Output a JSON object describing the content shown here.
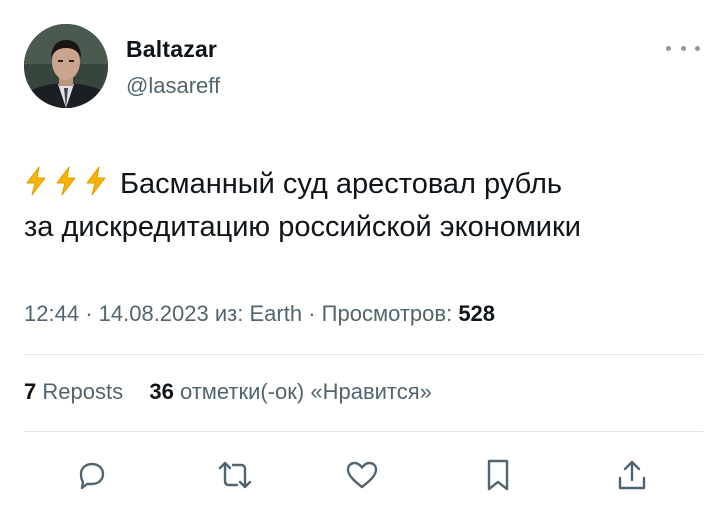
{
  "tweet": {
    "author_name": "Baltazar",
    "author_handle": "@lasareff",
    "emoji_prefix": "⚡⚡⚡",
    "text_line1": "Басманный суд арестовал рубль",
    "text_line2": "за дискредитацию российской экономики",
    "time": "12:44",
    "date": "14.08.2023",
    "source_prefix": "из:",
    "source": "Earth",
    "views_label": "Просмотров:",
    "views_count": "528",
    "reposts_count": "7",
    "reposts_label": "Reposts",
    "likes_count": "36",
    "likes_label": "отметки(-ок) «Нравится»"
  },
  "actions": [
    {
      "name": "reply",
      "icon": "speech-bubble-icon"
    },
    {
      "name": "repost",
      "icon": "repost-arrows-icon"
    },
    {
      "name": "like",
      "icon": "heart-icon"
    },
    {
      "name": "bookmark",
      "icon": "bookmark-icon"
    },
    {
      "name": "share",
      "icon": "share-upload-icon"
    }
  ],
  "colors": {
    "text": "#0f1419",
    "secondary": "#536471",
    "divider": "#e3e6e8",
    "bolt": "#f7b500"
  }
}
